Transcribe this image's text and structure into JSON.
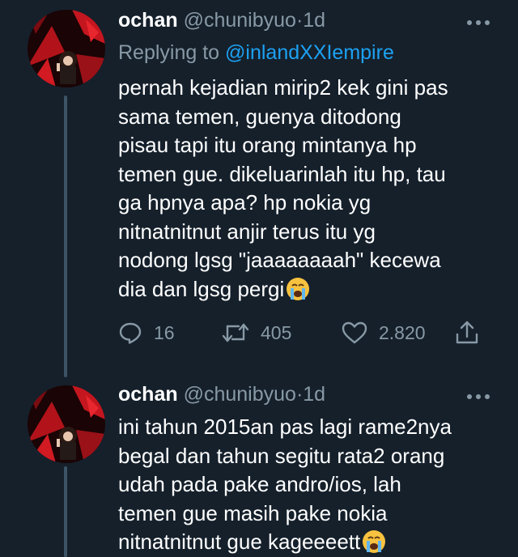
{
  "tweets": [
    {
      "display_name": "ochan",
      "handle": "@chunibyuo",
      "separator": "·",
      "time": "1d",
      "replying_prefix": "Replying to ",
      "replying_to": "@inlandXXIempire",
      "text": "pernah kejadian mirip2 kek gini pas\nsama temen, guenya ditodong\npisau tapi itu orang mintanya hp\ntemen gue. dikeluarinlah itu hp, tau\nga hpnya apa? hp nokia yg\nnitnatnitnut anjir terus itu yg\nnodong lgsg \"jaaaaaaaah\" kecewa\ndia dan lgsg pergi",
      "trailing_emoji": "loudly-crying-face",
      "stats": {
        "replies": "16",
        "retweets": "405",
        "likes": "2.820"
      }
    },
    {
      "display_name": "ochan",
      "handle": "@chunibyuo",
      "separator": "·",
      "time": "1d",
      "text": "ini tahun 2015an pas lagi rame2nya\nbegal dan tahun segitu rata2 orang\nudah pada pake andro/ios, lah\ntemen gue masih pake nokia\nnitnatnitnut gue kageeeett",
      "trailing_emoji": "loudly-crying-face"
    }
  ],
  "icons": {
    "reply": "reply-icon",
    "retweet": "retweet-icon",
    "like": "heart-icon",
    "share": "share-icon",
    "more": "more-icon"
  },
  "colors": {
    "background": "#15202b",
    "text_primary": "#ffffff",
    "text_secondary": "#8899a6",
    "link": "#1da1f2",
    "thread_line": "#3d5466"
  }
}
